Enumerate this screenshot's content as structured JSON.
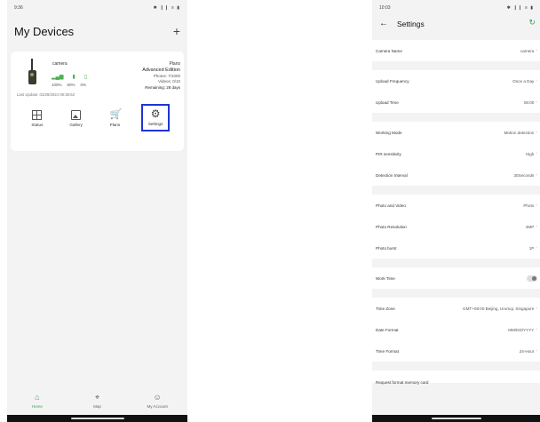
{
  "left": {
    "status": {
      "time": "9:36",
      "icons": "✱ ❙❙ ≡ ▮"
    },
    "header": {
      "title": "My Devices",
      "add_symbol": "+"
    },
    "card": {
      "name": "camera",
      "signal_icon": "▂▄▆",
      "battery_icon": "▮",
      "storage_icon": "▯",
      "signal_value": "100%",
      "battery_value": "60%",
      "storage_value": "0%",
      "plan_label": "Plans",
      "plan_edition": "Advanced Edition",
      "photos": "Photos: 7/1000",
      "videos": "Videos: 0/10",
      "remaining": "Remaining: 28 days",
      "last_update": "Last Update: 02/29/2024 09:35:52",
      "actions": [
        {
          "label": "Status",
          "icon": "grid-icon"
        },
        {
          "label": "Gallery",
          "icon": "gallery-icon"
        },
        {
          "label": "Plans",
          "icon": "cart-icon"
        },
        {
          "label": "Settings",
          "icon": "gear-icon"
        }
      ],
      "cart_glyph": "🛒",
      "gear_glyph": "⚙"
    },
    "tabs": [
      {
        "label": "Home",
        "glyph": "⌂"
      },
      {
        "label": "Map",
        "glyph": "⌖"
      },
      {
        "label": "My Account",
        "glyph": "☺"
      }
    ]
  },
  "right": {
    "status": {
      "time": "10:03",
      "icons": "✱ ❙❙ ≡ ▮"
    },
    "header": {
      "title": "Settings",
      "back": "←",
      "refresh": "↻"
    },
    "chevron": "›",
    "rows": {
      "camera_name": {
        "label": "Camera Name",
        "value": "camera"
      },
      "upload_frequency": {
        "label": "Upload Frequency",
        "value": "Once a Day"
      },
      "upload_time": {
        "label": "Upload Time",
        "value": "06:00"
      },
      "working_mode": {
        "label": "Working Mode",
        "value": "Motion detection"
      },
      "pir_sensitivity": {
        "label": "PIR sensitivity",
        "value": "High"
      },
      "detection_interval": {
        "label": "Detection Interval",
        "value": "30Seconds"
      },
      "photo_and_video": {
        "label": "Photo and Video",
        "value": "Photo"
      },
      "photo_resolution": {
        "label": "Photo Resolution",
        "value": "4MP"
      },
      "photo_burst": {
        "label": "Photo burst",
        "value": "1P"
      },
      "work_time": {
        "label": "Work Time"
      },
      "time_zone": {
        "label": "Time Zone",
        "value": "GMT+08:00 Beijing, Urumqi, Singapore"
      },
      "date_format": {
        "label": "Date Format",
        "value": "MM/DD/YYYY"
      },
      "time_format": {
        "label": "Time Format",
        "value": "24-Hour"
      },
      "format_card": {
        "label": "Request format memory card"
      }
    }
  }
}
